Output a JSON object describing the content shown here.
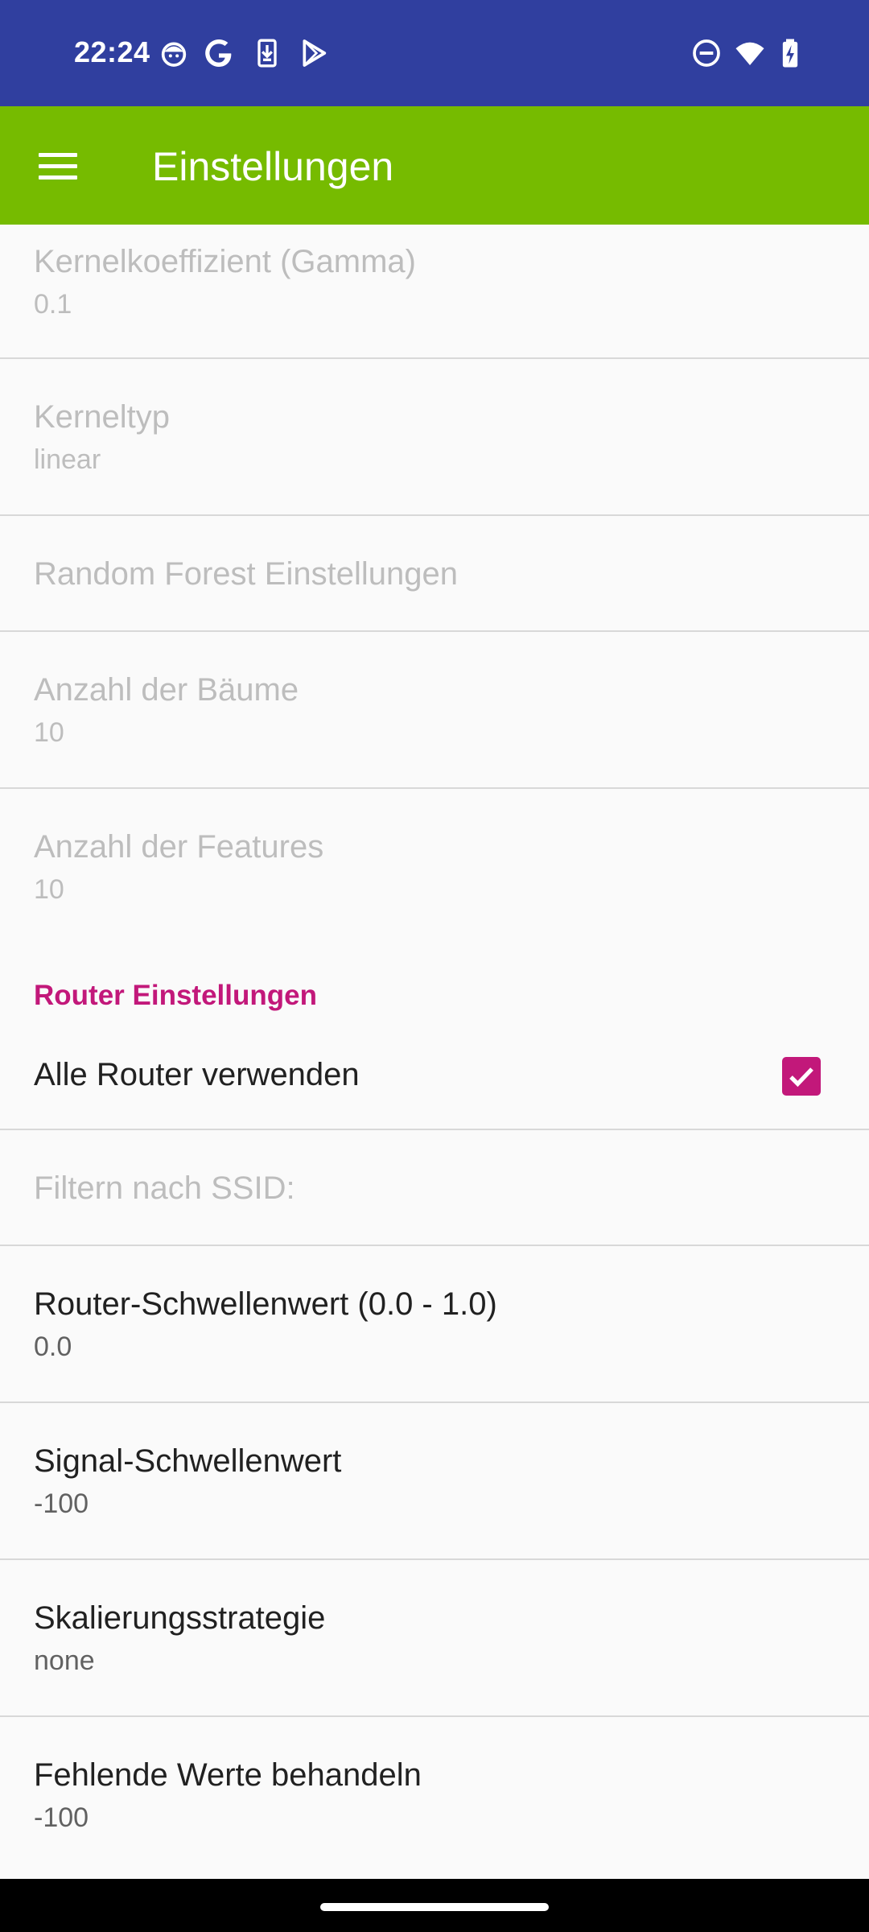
{
  "status_bar": {
    "time": "22:24",
    "left_icons": [
      "face-icon",
      "google-icon",
      "download-icon",
      "play-store-icon"
    ],
    "right_icons": [
      "do-not-disturb-icon",
      "wifi-icon",
      "battery-charging-icon"
    ]
  },
  "app_bar": {
    "title": "Einstellungen",
    "menu_icon": "hamburger-menu-icon"
  },
  "preferences": [
    {
      "title": "Kernelkoeffizient (Gamma)",
      "summary": "0.1",
      "enabled": false
    },
    {
      "title": "Kerneltyp",
      "summary": "linear",
      "enabled": false
    },
    {
      "title": "Random Forest Einstellungen",
      "enabled": false
    },
    {
      "title": "Anzahl der Bäume",
      "summary": "10",
      "enabled": false
    },
    {
      "title": "Anzahl der Features",
      "summary": "10",
      "enabled": false
    }
  ],
  "router_category": {
    "title": "Router Einstellungen",
    "items": [
      {
        "title": "Alle Router verwenden",
        "checked": true
      },
      {
        "title": "Filtern nach SSID:",
        "enabled": false
      },
      {
        "title": "Router-Schwellenwert (0.0 - 1.0)",
        "summary": "0.0"
      },
      {
        "title": "Signal-Schwellenwert",
        "summary": "-100"
      },
      {
        "title": "Skalierungsstrategie",
        "summary": "none"
      },
      {
        "title": "Fehlende Werte behandeln",
        "summary": "-100"
      }
    ]
  },
  "colors": {
    "status_bar": "#303f9f",
    "app_bar": "#76bb00",
    "accent": "#c2187a",
    "background": "#fafafa"
  }
}
